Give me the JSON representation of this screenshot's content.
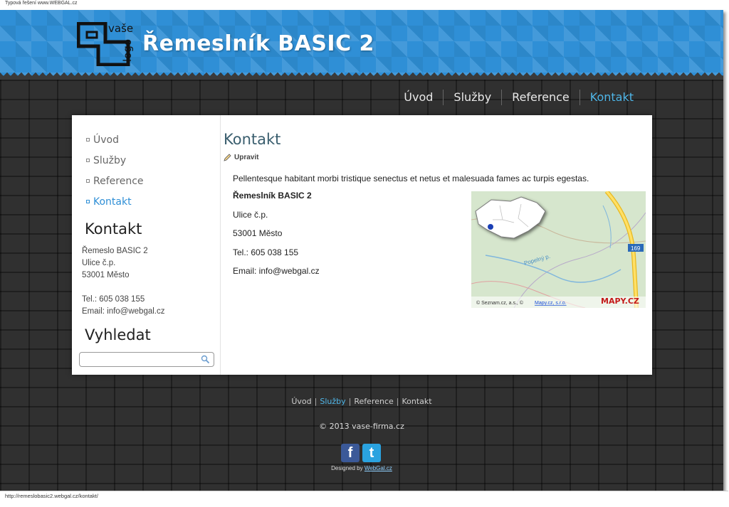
{
  "caption": "Typová řešení www.WEBGAL.cz",
  "header": {
    "logo_line1": "vaše",
    "logo_line2": "logo",
    "site_title": "Řemeslník BASIC 2"
  },
  "top_nav": [
    {
      "label": "Úvod",
      "active": false
    },
    {
      "label": "Služby",
      "active": false
    },
    {
      "label": "Reference",
      "active": false
    },
    {
      "label": "Kontakt",
      "active": true
    }
  ],
  "sidebar": {
    "menu": [
      {
        "label": "Úvod",
        "active": false
      },
      {
        "label": "Služby",
        "active": false
      },
      {
        "label": "Reference",
        "active": false
      },
      {
        "label": "Kontakt",
        "active": true
      }
    ],
    "contact_title": "Kontakt",
    "contact_lines": [
      "Řemeslo BASIC 2",
      "Ulice č.p.",
      "53001 Město",
      "",
      "Tel.: 605 038 155",
      "Email: info@webgal.cz"
    ],
    "search_title": "Vyhledat",
    "search_value": ""
  },
  "main": {
    "title": "Kontakt",
    "edit_label": "Upravit",
    "intro": "Pellentesque habitant morbi tristique senectus et netus et malesuada fames ac turpis egestas.",
    "company": "Řemeslník BASIC 2",
    "street": "Ulice č.p.",
    "city": "53001 Město",
    "phone": "Tel.: 605 038 155",
    "email": "Email: info@webgal.cz"
  },
  "map": {
    "road_number": "169",
    "stream_label": "Popelný p.",
    "credit": "© Seznam.cz, a.s., ©",
    "credit_link": "Mapy.cz, s.r.o.",
    "brand": "MAPY.CZ"
  },
  "footer": {
    "links": [
      {
        "label": "Úvod",
        "highlight": false
      },
      {
        "label": "Služby",
        "highlight": true
      },
      {
        "label": "Reference",
        "highlight": false
      },
      {
        "label": "Kontakt",
        "highlight": false
      }
    ],
    "copyright": "© 2013 vase-firma.cz",
    "designed_by": "Designed by",
    "designed_link": "WebGal.cz"
  },
  "status_url": "http://remeslobasic2.webgal.cz/kontakt/",
  "colors": {
    "accent": "#2f8fd6",
    "header_bg": "#2f8fd6",
    "body_dark": "#303030"
  }
}
